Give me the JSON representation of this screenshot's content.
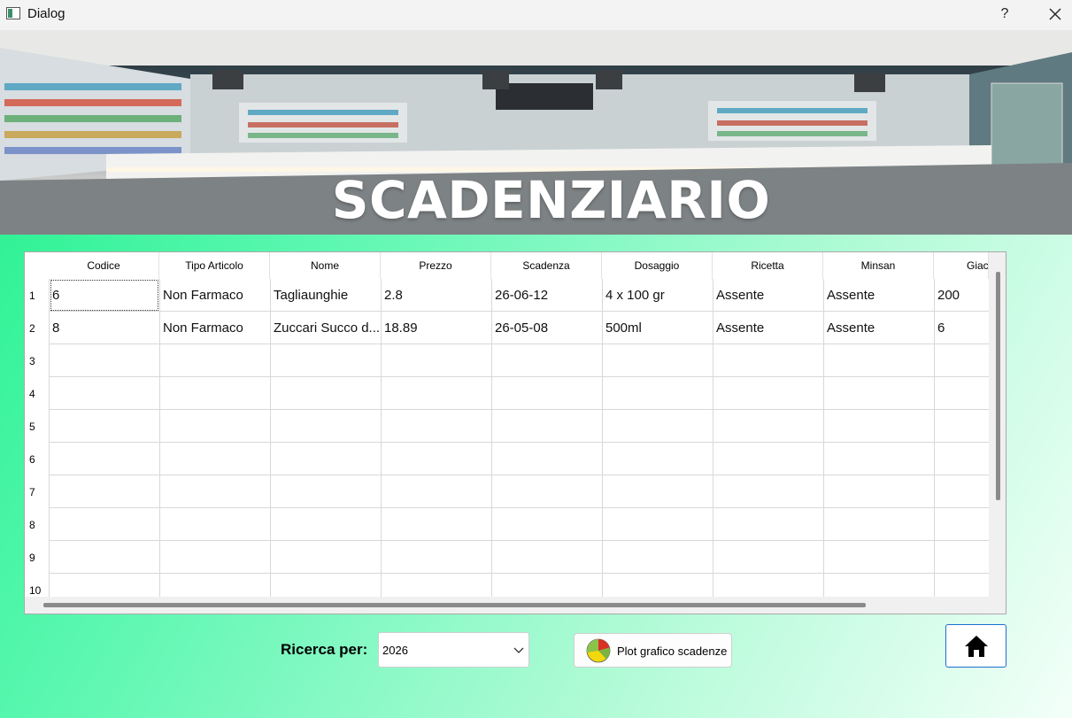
{
  "window": {
    "title": "Dialog",
    "help_label": "?"
  },
  "banner": {
    "title": "SCADENZIARIO"
  },
  "table": {
    "columns": [
      "Codice",
      "Tipo Articolo",
      "Nome",
      "Prezzo",
      "Scadenza",
      "Dosaggio",
      "Ricetta",
      "Minsan",
      "Giac"
    ],
    "row_numbers": [
      "1",
      "2",
      "3",
      "4",
      "5",
      "6",
      "7",
      "8",
      "9",
      "10"
    ],
    "rows": [
      [
        "6",
        "Non Farmaco",
        "Tagliaunghie",
        "2.8",
        "26-06-12",
        "4 x 100 gr",
        "Assente",
        "Assente",
        "200"
      ],
      [
        "8",
        "Non Farmaco",
        "Zuccari Succo d...",
        "18.89",
        "26-05-08",
        "500ml",
        "Assente",
        "Assente",
        "6"
      ]
    ]
  },
  "search": {
    "label": "Ricerca per:",
    "selected": "2026"
  },
  "plot_button": {
    "label": "Plot grafico scadenze"
  },
  "icons": {
    "app": "window-icon",
    "close": "close-icon",
    "dropdown": "chevron-down-icon",
    "plot": "pie-chart-icon",
    "home": "home-icon"
  },
  "colors": {
    "accent_border": "#1a6fd1",
    "bg_start": "#1ff08a",
    "bg_end": "#f3fff9"
  }
}
